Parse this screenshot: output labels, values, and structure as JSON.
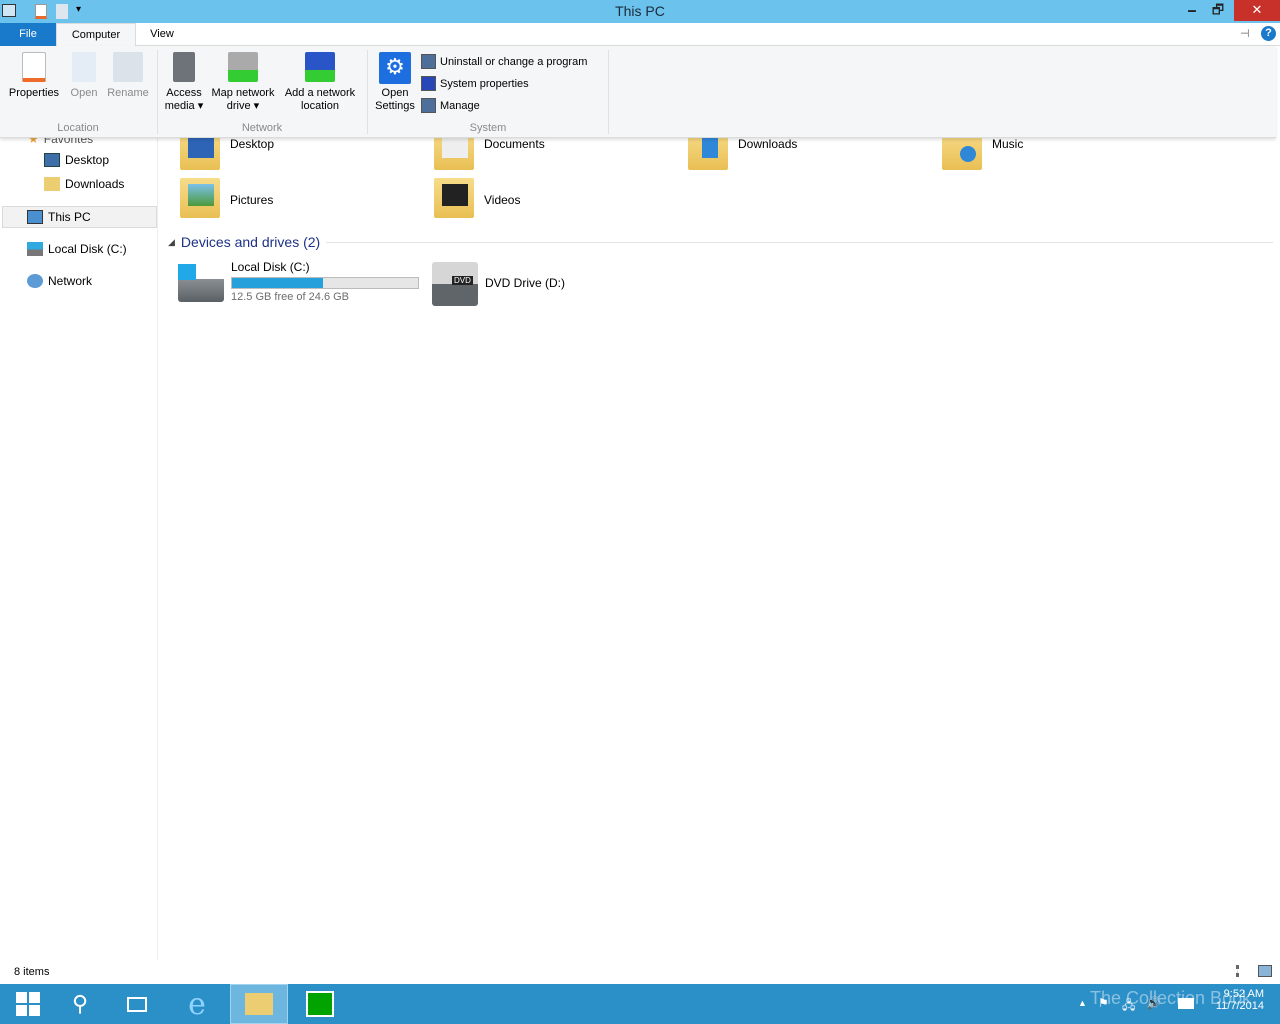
{
  "window": {
    "title": "This PC",
    "minimize": "🗕",
    "maximize": "🗗",
    "close": "✕"
  },
  "tabs": {
    "file": "File",
    "computer": "Computer",
    "view": "View"
  },
  "ribbon": {
    "location": {
      "label": "Location",
      "properties": "Properties",
      "open": "Open",
      "rename": "Rename"
    },
    "network": {
      "label": "Network",
      "access_media": [
        "Access",
        "media ▾"
      ],
      "map_drive": [
        "Map network",
        "drive ▾"
      ],
      "add_location": [
        "Add a network",
        "location"
      ]
    },
    "system": {
      "label": "System",
      "open_settings": [
        "Open",
        "Settings"
      ],
      "uninstall": "Uninstall or change a program",
      "system_properties": "System properties",
      "manage": "Manage"
    }
  },
  "sidebar": {
    "favorites": "Favorites",
    "items": [
      {
        "label": "Desktop"
      },
      {
        "label": "Downloads"
      },
      {
        "label": "This PC"
      },
      {
        "label": "Local Disk (C:)"
      },
      {
        "label": "Network"
      }
    ]
  },
  "folders": [
    {
      "label": "Desktop"
    },
    {
      "label": "Documents"
    },
    {
      "label": "Downloads"
    },
    {
      "label": "Music"
    },
    {
      "label": "Pictures"
    },
    {
      "label": "Videos"
    }
  ],
  "devices": {
    "header": "Devices and drives (2)",
    "drives": [
      {
        "label": "Local Disk (C:)",
        "free": "12.5 GB free of 24.6 GB",
        "used_fraction": 0.49
      },
      {
        "label": "DVD Drive (D:)",
        "badge": "DVD"
      }
    ]
  },
  "status": {
    "items": "8 items"
  },
  "taskbar": {
    "time": "9:52 AM",
    "date": "11/7/2014",
    "watermark": "The Collection Book"
  },
  "colors": {
    "accent": "#1979ca",
    "titlebar": "#6bc2ec",
    "taskbar": "#2b8fc8",
    "progress": "#26a0da"
  }
}
